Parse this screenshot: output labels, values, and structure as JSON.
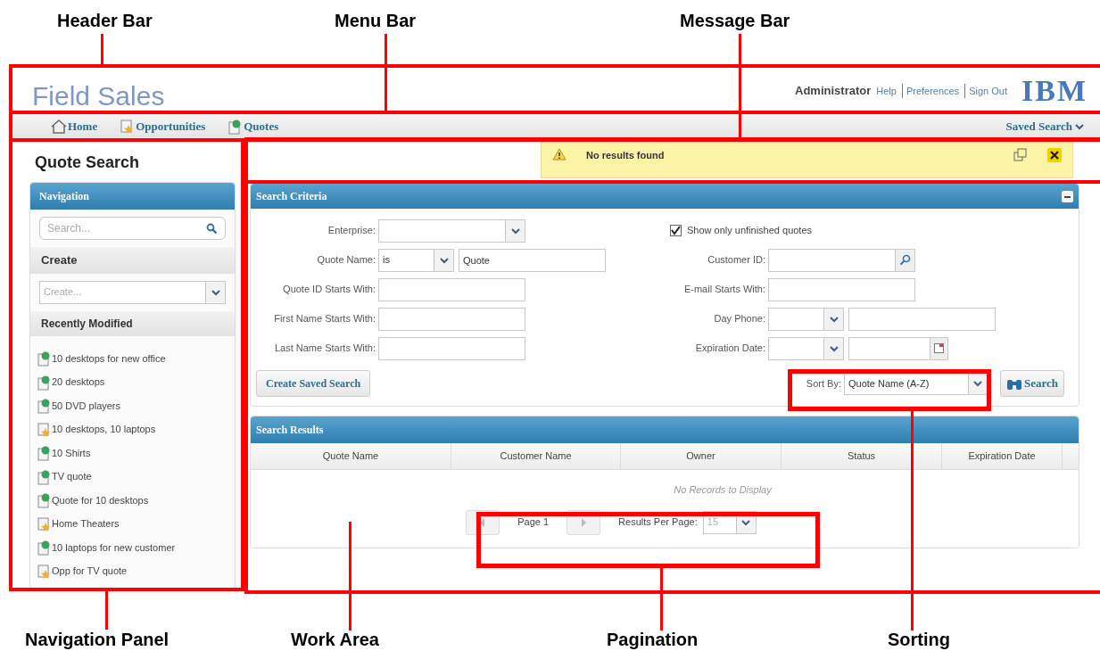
{
  "callouts_top": [
    {
      "label": "Header Bar"
    },
    {
      "label": "Menu Bar"
    },
    {
      "label": "Message Bar"
    }
  ],
  "callouts_bottom": [
    {
      "label": "Navigation Panel"
    },
    {
      "label": "Work Area"
    },
    {
      "label": "Pagination"
    },
    {
      "label": "Sorting"
    }
  ],
  "header": {
    "app_title": "Field Sales",
    "user": "Administrator",
    "links": [
      "Help",
      "Preferences",
      "Sign Out"
    ],
    "logo": "IBM"
  },
  "menu": {
    "items": [
      {
        "label": "Home",
        "kind": "home"
      },
      {
        "label": "Opportunities",
        "kind": "opportunity"
      },
      {
        "label": "Quotes",
        "kind": "quote"
      }
    ],
    "saved_search": "Saved Search"
  },
  "sidebar": {
    "title": "Quote Search",
    "navigation": "Navigation",
    "search_placeholder": "Search...",
    "create_heading": "Create",
    "create_placeholder": "Create...",
    "recent_heading": "Recently Modified",
    "items": [
      {
        "label": "10 desktops for new office",
        "kind": "quote"
      },
      {
        "label": "20 desktops",
        "kind": "quote"
      },
      {
        "label": "50 DVD players",
        "kind": "quote"
      },
      {
        "label": "10 desktops, 10 laptops",
        "kind": "opportunity"
      },
      {
        "label": "10 Shirts",
        "kind": "quote"
      },
      {
        "label": "TV quote",
        "kind": "quote"
      },
      {
        "label": "Quote for 10 desktops",
        "kind": "quote"
      },
      {
        "label": "Home Theaters",
        "kind": "opportunity"
      },
      {
        "label": "10 laptops for new customer",
        "kind": "quote"
      },
      {
        "label": "Opp for TV quote",
        "kind": "opportunity"
      }
    ]
  },
  "message": {
    "text": "No results found"
  },
  "criteria": {
    "title": "Search Criteria",
    "left_fields": [
      {
        "label": "Enterprise:",
        "kind": "select"
      },
      {
        "label": "Quote Name:",
        "kind": "operator_text",
        "operator": "is",
        "value": "Quote"
      },
      {
        "label": "Quote ID Starts With:",
        "kind": "text"
      },
      {
        "label": "First Name Starts With:",
        "kind": "text"
      },
      {
        "label": "Last Name Starts With:",
        "kind": "text"
      }
    ],
    "unfinished": {
      "label": "Show only unfinished quotes",
      "checked": true
    },
    "right_fields": [
      {
        "label": "Customer ID:",
        "kind": "lookup"
      },
      {
        "label": "E-mail Starts With:",
        "kind": "text"
      },
      {
        "label": "Day Phone:",
        "kind": "select_text"
      },
      {
        "label": "Expiration Date:",
        "kind": "select_date"
      }
    ],
    "create_saved_search": "Create Saved Search",
    "sort_label": "Sort By:",
    "sort_value": "Quote Name (A-Z)",
    "search_button": "Search"
  },
  "results": {
    "title": "Search Results",
    "columns": [
      "Quote Name",
      "Customer Name",
      "Owner",
      "Status",
      "Expiration Date"
    ],
    "empty": "No Records to Display",
    "page": "Page 1",
    "per_page_label": "Results Per Page:",
    "per_page": {
      "value": "15",
      "disabled": true
    }
  }
}
